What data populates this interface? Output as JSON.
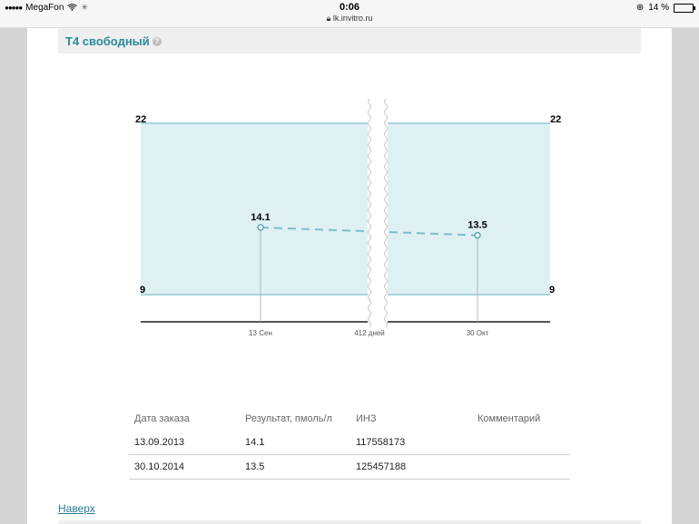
{
  "statusbar": {
    "carrier": "MegaFon",
    "time": "0:06",
    "url": "lk.invitro.ru",
    "battery": "14 %",
    "battery_level": 0.14
  },
  "section": {
    "title": "Т4 свободный",
    "help_icon": "?"
  },
  "chart_data": {
    "type": "line",
    "xlabel": "",
    "ylabel": "",
    "reference_range": [
      9,
      22
    ],
    "ylim": [
      9,
      22
    ],
    "x_ticks": [
      "13 Сен",
      "412 дней",
      "30 Окт"
    ],
    "axis_break": true,
    "points": [
      {
        "x": "13.09.2013",
        "label": "13 Сен",
        "y": 14.1
      },
      {
        "x": "30.10.2014",
        "label": "30 Окт",
        "y": 13.5
      }
    ],
    "left_ticks": [
      "22",
      "9"
    ],
    "right_ticks": [
      "22",
      "9"
    ],
    "colors": {
      "band": "#dff0f3",
      "band_border": "#a9d3da",
      "line": "#7bbfc8",
      "marker": "#5aa6b2"
    }
  },
  "table": {
    "headers": [
      "Дата заказа",
      "Результат, пмоль/л",
      "ИНЗ",
      "Комментарий"
    ],
    "rows": [
      [
        "13.09.2013",
        "14.1",
        "117558173",
        ""
      ],
      [
        "30.10.2014",
        "13.5",
        "125457188",
        ""
      ]
    ]
  },
  "nav": {
    "back_to_top": "Наверх"
  }
}
